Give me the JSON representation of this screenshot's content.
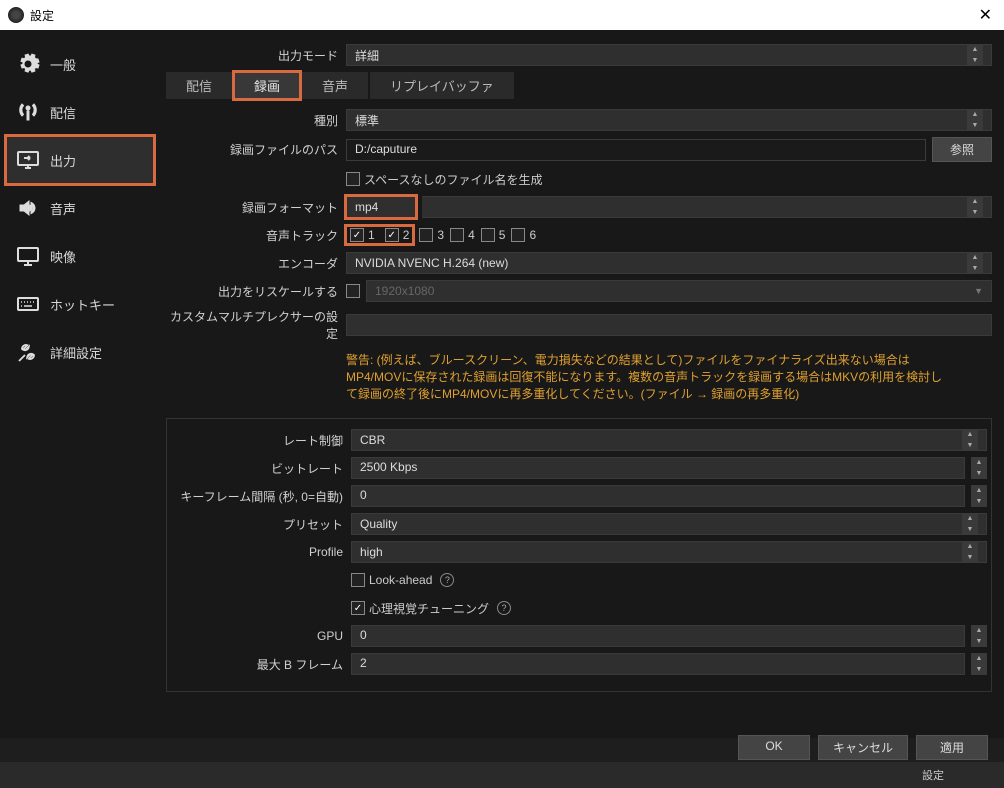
{
  "window": {
    "title": "設定"
  },
  "sidebar": {
    "items": [
      {
        "label": "一般"
      },
      {
        "label": "配信"
      },
      {
        "label": "出力"
      },
      {
        "label": "音声"
      },
      {
        "label": "映像"
      },
      {
        "label": "ホットキー"
      },
      {
        "label": "詳細設定"
      }
    ]
  },
  "output_mode": {
    "label": "出力モード",
    "value": "詳細"
  },
  "tabs": {
    "stream": "配信",
    "record": "録画",
    "audio": "音声",
    "replay": "リプレイバッファ"
  },
  "rec": {
    "type_label": "種別",
    "type_value": "標準",
    "path_label": "録画ファイルのパス",
    "path_value": "D:/caputure",
    "browse": "参照",
    "nospace_label": "スペースなしのファイル名を生成",
    "format_label": "録画フォーマット",
    "format_value": "mp4",
    "tracks_label": "音声トラック",
    "tracks": [
      "1",
      "2",
      "3",
      "4",
      "5",
      "6"
    ],
    "encoder_label": "エンコーダ",
    "encoder_value": "NVIDIA NVENC H.264 (new)",
    "rescale_label": "出力をリスケールする",
    "rescale_value": "1920x1080",
    "mux_label": "カスタムマルチプレクサーの設定"
  },
  "warning": "警告: (例えば、ブルースクリーン、電力損失などの結果として)ファイルをファイナライズ出来ない場合はMP4/MOVに保存された録画は回復不能になります。複数の音声トラックを録画する場合はMKVの利用を検討して録画の終了後にMP4/MOVに再多重化してください。(ファイル → 録画の再多重化)",
  "enc": {
    "rate_label": "レート制御",
    "rate_value": "CBR",
    "bitrate_label": "ビットレート",
    "bitrate_value": "2500 Kbps",
    "keyframe_label": "キーフレーム間隔 (秒, 0=自動)",
    "keyframe_value": "0",
    "preset_label": "プリセット",
    "preset_value": "Quality",
    "profile_label": "Profile",
    "profile_value": "high",
    "lookahead_label": "Look-ahead",
    "psycho_label": "心理視覚チューニング",
    "gpu_label": "GPU",
    "gpu_value": "0",
    "bframes_label": "最大 B フレーム",
    "bframes_value": "2"
  },
  "footer": {
    "ok": "OK",
    "cancel": "キャンセル",
    "apply": "適用"
  },
  "bottom": {
    "settings": "設定"
  }
}
